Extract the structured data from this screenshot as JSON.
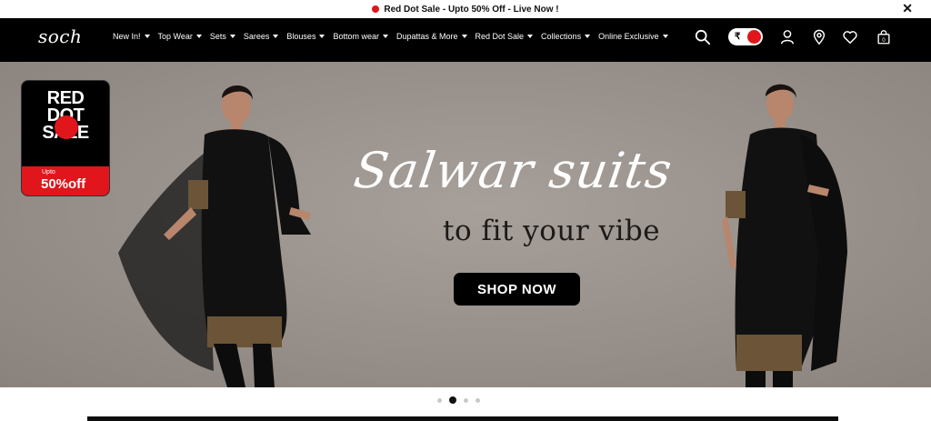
{
  "announcement": {
    "text": "Red Dot Sale - Upto 50% Off - Live Now !",
    "close": "✕"
  },
  "brand": {
    "logo": "soch"
  },
  "nav": {
    "items": [
      {
        "label": "New In!"
      },
      {
        "label": "Top Wear"
      },
      {
        "label": "Sets"
      },
      {
        "label": "Sarees"
      },
      {
        "label": "Blouses"
      },
      {
        "label": "Bottom wear"
      },
      {
        "label": "Dupattas & More"
      },
      {
        "label": "Red Dot Sale"
      },
      {
        "label": "Collections"
      },
      {
        "label": "Online Exclusive"
      }
    ],
    "currency_symbol": "₹",
    "cart_count": "0",
    "icons": [
      "search-icon",
      "currency-toggle",
      "user-icon",
      "location-pin-icon",
      "heart-icon",
      "shopping-bag-icon"
    ]
  },
  "hero": {
    "badge": {
      "line1": "RED",
      "line2": "DOT",
      "line3": "SALE",
      "upto": "Upto",
      "discount": "50%off"
    },
    "headline": "Salwar suits",
    "subheadline": "to fit your vibe",
    "cta": "SHOP NOW"
  },
  "carousel": {
    "slides": 4,
    "active_index": 1
  },
  "colors": {
    "accent": "#e0161c",
    "nav_bg": "#000000",
    "hero_bg": "#9a928c"
  }
}
